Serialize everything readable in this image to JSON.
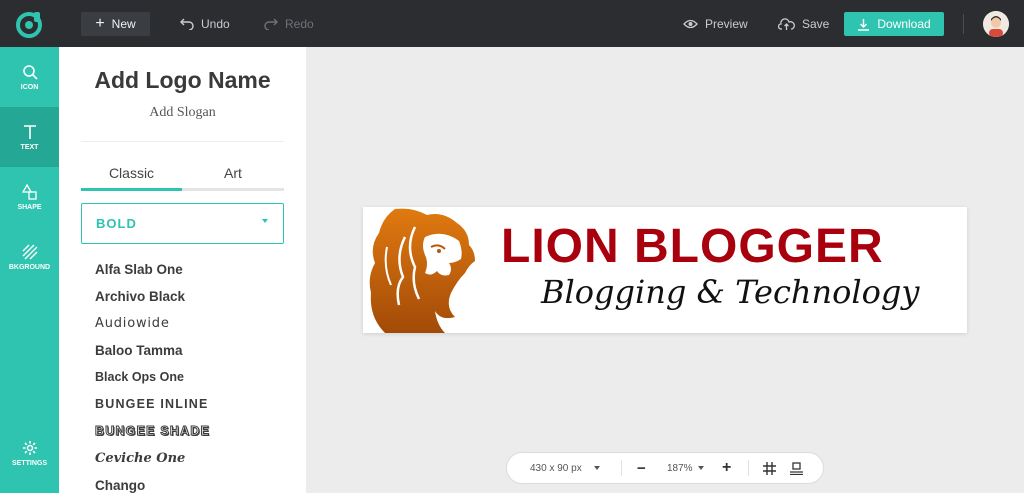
{
  "toolbar": {
    "new_label": "New",
    "undo_label": "Undo",
    "redo_label": "Redo",
    "preview_label": "Preview",
    "save_label": "Save",
    "download_label": "Download"
  },
  "rail": {
    "items": [
      {
        "label": "ICON",
        "icon": "search-icon"
      },
      {
        "label": "TEXT",
        "icon": "text-icon"
      },
      {
        "label": "SHAPE",
        "icon": "shapes-icon"
      },
      {
        "label": "BKGROUND",
        "icon": "background-icon"
      },
      {
        "label": "SETTINGS",
        "icon": "gear-icon"
      }
    ],
    "active": "TEXT"
  },
  "panel": {
    "logo_name": "Add Logo Name",
    "slogan": "Add Slogan",
    "tabs": [
      {
        "label": "Classic",
        "active": true
      },
      {
        "label": "Art",
        "active": false
      }
    ],
    "font_category": "BOLD",
    "fonts": [
      "Alfa Slab One",
      "Archivo Black",
      "Audiowide",
      "Baloo Tamma",
      "Black Ops One",
      "BUNGEE INLINE",
      "BUNGEE SHADE",
      "Ceviche One",
      "Chango"
    ]
  },
  "artboard": {
    "brand_text": "LION BLOGGER",
    "tagline": "Blogging  & Technology",
    "brand_color": "#a8000c",
    "icon": "lion-head-icon"
  },
  "zoombar": {
    "canvas_size": "430 x 90 px",
    "zoom": "187%",
    "minus": "−",
    "plus": "+"
  },
  "colors": {
    "accent": "#2ec4b0",
    "topbar": "#2b2d31"
  }
}
